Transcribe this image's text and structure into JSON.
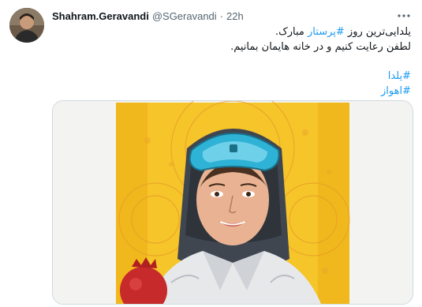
{
  "tweet": {
    "author_name": "Shahram.Geravandi",
    "author_handle": "@SGeravandi",
    "separator": "·",
    "timestamp": "22h",
    "more_icon": "more-horizontal-icon",
    "text": {
      "line1_prefix": "یلدایی‌ترین روز ",
      "line1_hashtag": "#پرستار",
      "line1_suffix": " مبارک.",
      "line2": "لطفن رعایت کنیم و در خانه هایمان بمانیم.",
      "hashtag1": "#یلدا",
      "hashtag2": "#اهواز"
    },
    "media": {
      "description_icon": "illustration-image"
    }
  },
  "colors": {
    "link": "#1d9bf0",
    "text": "#0f1419",
    "muted": "#536471",
    "goggles": "#2eb2d6",
    "background_art": "#f5c52a"
  }
}
